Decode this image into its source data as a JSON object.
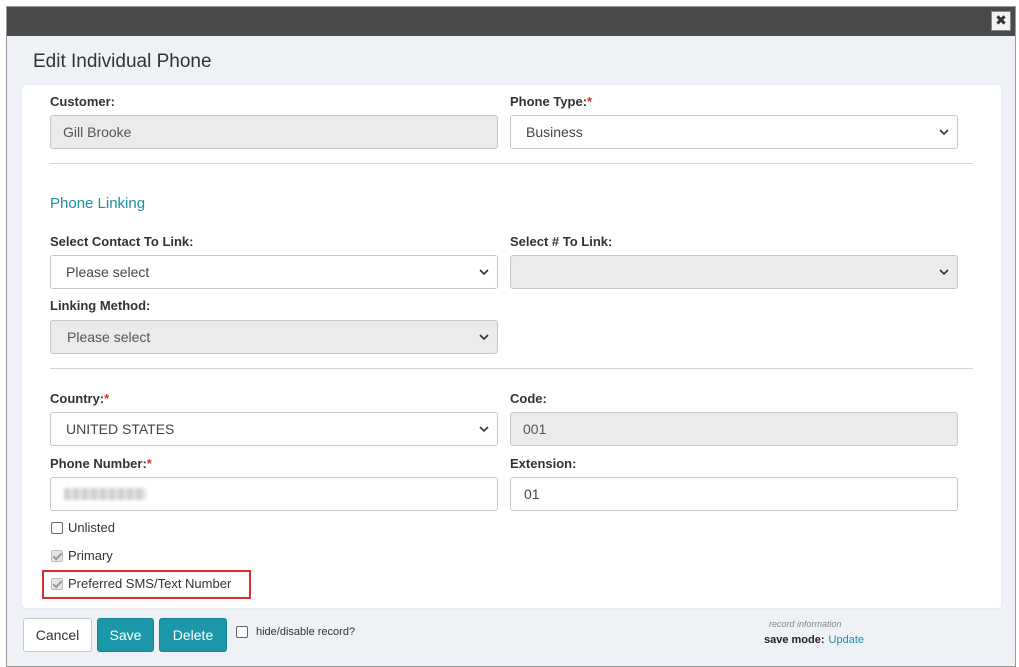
{
  "dialog": {
    "title": "Edit Individual Phone",
    "close_symbol": "✖"
  },
  "form": {
    "customer_label": "Customer:",
    "customer_value": "Gill Brooke",
    "phone_type_label": "Phone Type:",
    "phone_type_value": "Business",
    "required_mark": "*",
    "phone_linking_title": "Phone Linking",
    "select_contact_label": "Select Contact To Link:",
    "select_contact_value": "Please select",
    "select_number_label": "Select # To Link:",
    "select_number_value": "",
    "linking_method_label": "Linking Method:",
    "linking_method_value": "Please select",
    "country_label": "Country:",
    "country_value": "UNITED STATES",
    "code_label": "Code:",
    "code_value": "001",
    "phone_number_label": "Phone Number:",
    "extension_label": "Extension:",
    "extension_value": "01",
    "unlisted_label": "Unlisted",
    "primary_label": "Primary",
    "preferred_sms_label": "Preferred SMS/Text Number"
  },
  "footer": {
    "cancel_label": "Cancel",
    "save_label": "Save",
    "delete_label": "Delete",
    "hide_record_label": "hide/disable record?",
    "record_info_label": "record information",
    "save_mode_label": "save mode:",
    "save_mode_value": "Update"
  },
  "colors": {
    "accent": "#1b97a8",
    "link": "#1f8ea5",
    "required": "#d9302a",
    "highlight": "#d9302a",
    "titlebar": "#4a4a4a"
  }
}
